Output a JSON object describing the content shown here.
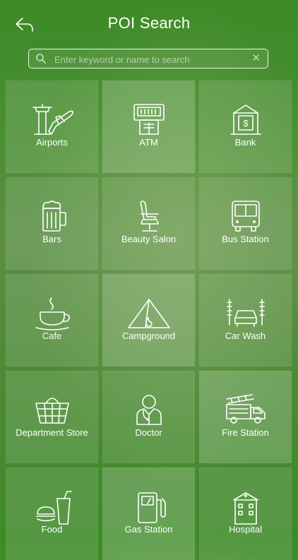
{
  "header": {
    "title": "POI Search",
    "back_icon": "back-arrow-icon"
  },
  "search": {
    "placeholder": "Enter keyword or name to search",
    "value": "",
    "clear_glyph": "✕",
    "search_icon": "magnifier-icon"
  },
  "categories": [
    {
      "label": "Airports",
      "icon": "airport-icon"
    },
    {
      "label": "ATM",
      "icon": "atm-icon"
    },
    {
      "label": "Bank",
      "icon": "bank-icon"
    },
    {
      "label": "Bars",
      "icon": "beer-mug-icon"
    },
    {
      "label": "Beauty Salon",
      "icon": "salon-chair-icon"
    },
    {
      "label": "Bus Station",
      "icon": "bus-icon"
    },
    {
      "label": "Cafe",
      "icon": "coffee-cup-icon"
    },
    {
      "label": "Campground",
      "icon": "tent-icon"
    },
    {
      "label": "Car Wash",
      "icon": "car-wash-icon"
    },
    {
      "label": "Department Store",
      "icon": "shopping-basket-icon"
    },
    {
      "label": "Doctor",
      "icon": "doctor-icon"
    },
    {
      "label": "Fire Station",
      "icon": "fire-truck-icon"
    },
    {
      "label": "Food",
      "icon": "food-icon"
    },
    {
      "label": "Gas Station",
      "icon": "gas-pump-icon"
    },
    {
      "label": "Hospital",
      "icon": "hospital-icon"
    }
  ],
  "colors": {
    "background": "#4a8f32",
    "tile": "rgba(255,255,255,0.12)",
    "text": "#ffffff"
  }
}
